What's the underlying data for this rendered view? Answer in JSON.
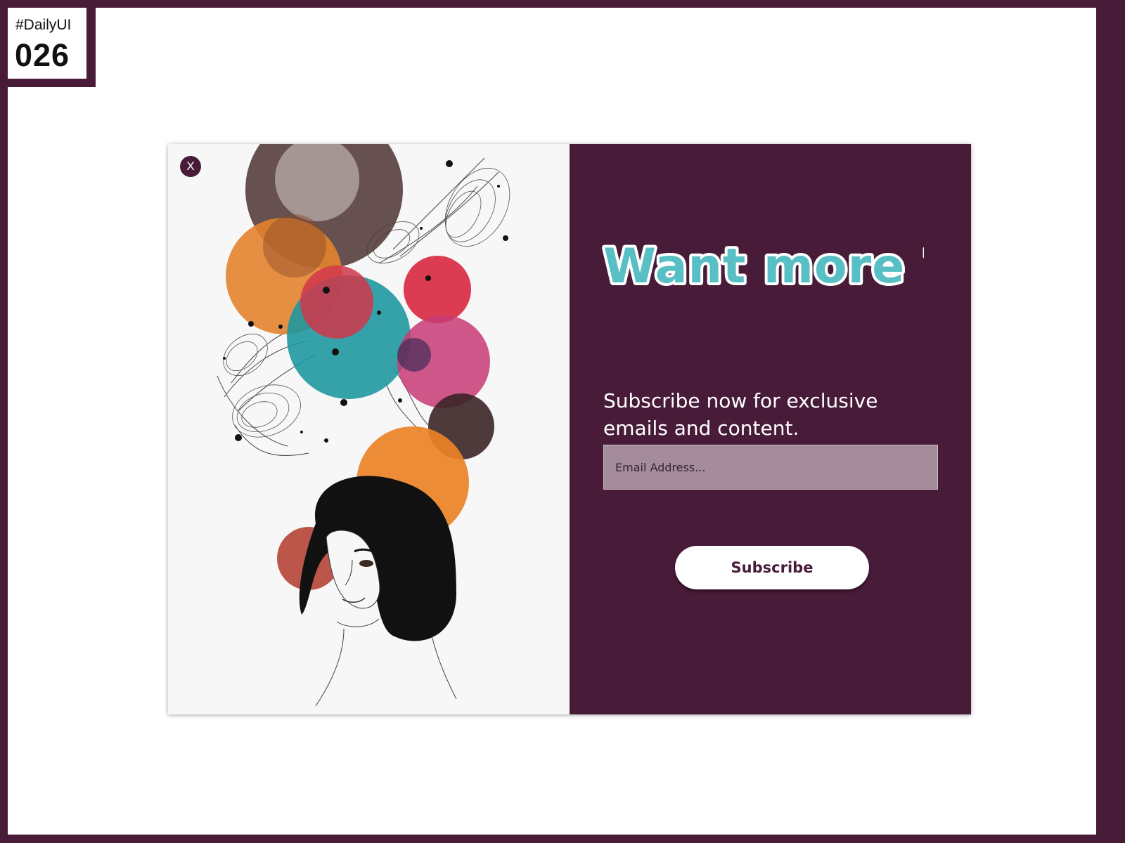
{
  "badge": {
    "tag": "#DailyUI",
    "number": "026"
  },
  "modal": {
    "close_label": "X",
    "headline": "Want more ?",
    "subtitle": "Subscribe now for exclusive emails and content.",
    "email_placeholder": "Email Address...",
    "subscribe_label": "Subscribe"
  },
  "colors": {
    "frame": "#481b39",
    "panel": "#481b39",
    "headline_fill": "#58bfc4",
    "headline_outline": "#ffffff",
    "input_bg": "#a58c9b",
    "button_bg": "#ffffff"
  },
  "illustration": {
    "name": "watercolor-woman-illustration"
  }
}
